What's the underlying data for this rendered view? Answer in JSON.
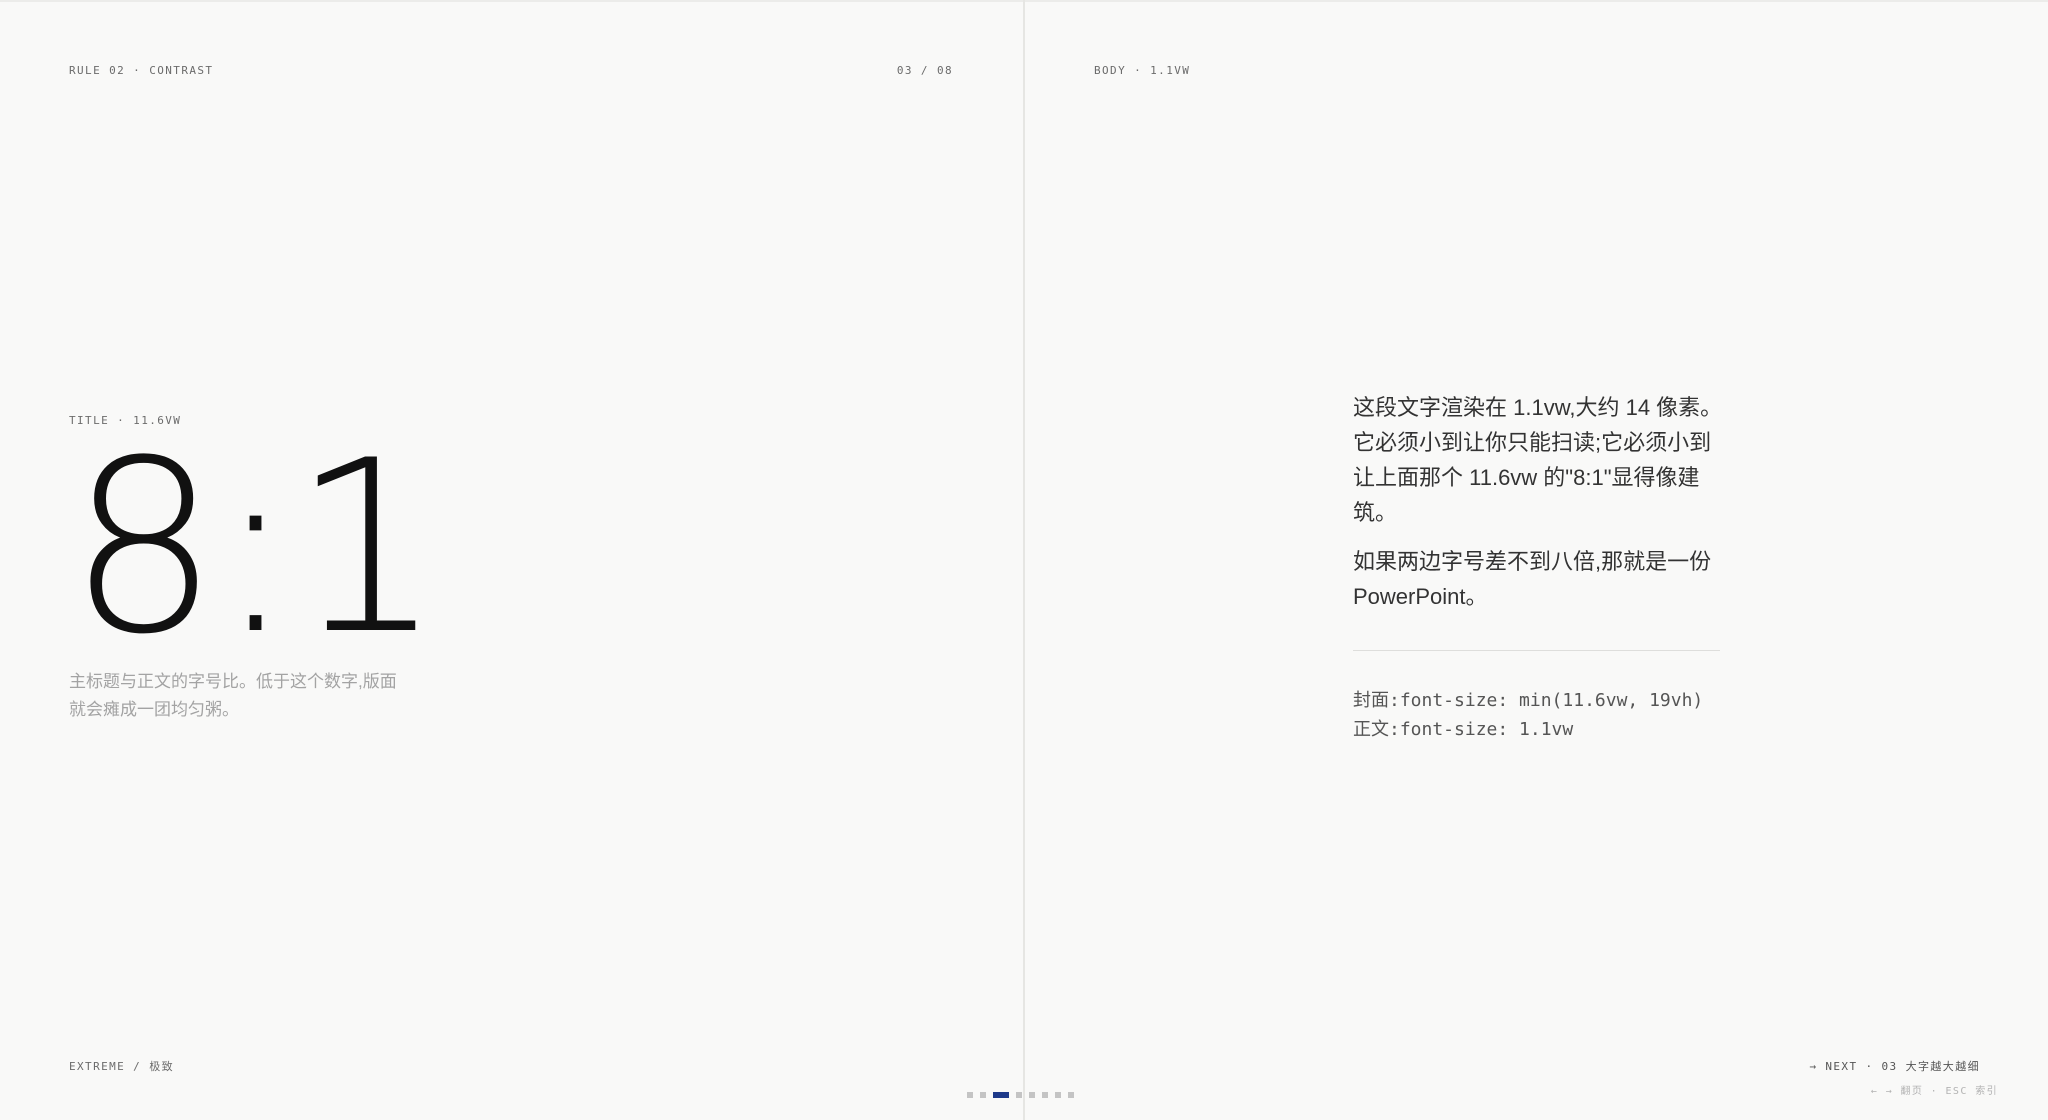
{
  "header": {
    "rule_label": "RULE 02 · CONTRAST",
    "page_counter": "03 / 08",
    "body_label": "BODY · 1.1VW"
  },
  "left": {
    "title_label": "TITLE · 11.6VW",
    "ratio": "8:1",
    "caption": "主标题与正文的字号比。低于这个数字,版面就会瘫成一团均匀粥。"
  },
  "right": {
    "paragraph_1": "这段文字渲染在 1.1vw,大约 14 像素。它必须小到让你只能扫读;它必须小到让上面那个 11.6vw 的\"8:1\"显得像建筑。",
    "paragraph_2": "如果两边字号差不到八倍,那就是一份 PowerPoint。",
    "code_line_1": "封面:font-size: min(11.6vw, 19vh)",
    "code_line_2": "正文:font-size: 1.1vw"
  },
  "footer": {
    "left_label": "EXTREME / 极致",
    "next_label": "→ NEXT · 03 大字越大越细",
    "hints": "← → 翻页 · ESC 索引"
  },
  "pager": {
    "total": 8,
    "current": 3
  },
  "colors": {
    "background": "#f9f9f8",
    "accent": "#1e3a8a",
    "ink": "#111111",
    "muted": "#a3a3a3"
  }
}
